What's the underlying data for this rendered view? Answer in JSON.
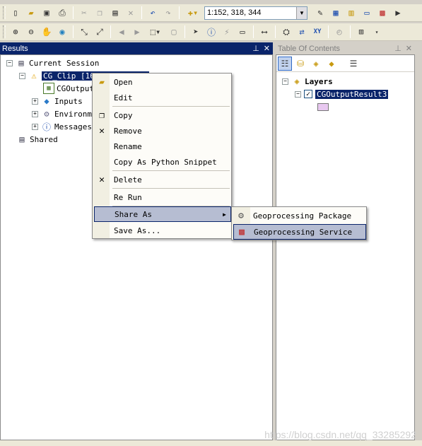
{
  "toolbar": {
    "scale_value": "1:152, 318, 344"
  },
  "results_panel": {
    "title": "Results",
    "pin_icon": "pin-icon",
    "close_icon": "close-icon",
    "tree": {
      "current_session": "Current Session",
      "clip_item": "CG_Clip [16",
      "output_item": "CGOutput",
      "inputs": "Inputs",
      "environments": "Environm",
      "messages": "Messages",
      "shared": "Shared"
    }
  },
  "toc_panel": {
    "title": "Table Of Contents",
    "layers_label": "Layers",
    "layer_name": "CGOutputResult3",
    "swatch_color": "#e8c8f0"
  },
  "context_menu": {
    "items": [
      {
        "label": "Open"
      },
      {
        "label": "Edit"
      },
      {
        "label": "Copy"
      },
      {
        "label": "Remove"
      },
      {
        "label": "Rename"
      },
      {
        "label": "Copy As Python Snippet"
      },
      {
        "label": "Delete"
      },
      {
        "label": "Re Run"
      },
      {
        "label": "Share As"
      },
      {
        "label": "Save As..."
      }
    ]
  },
  "submenu": {
    "items": [
      {
        "label": "Geoprocessing Package"
      },
      {
        "label": "Geoprocessing Service"
      }
    ]
  },
  "watermark": "https://blog.csdn.net/qq_33285292"
}
